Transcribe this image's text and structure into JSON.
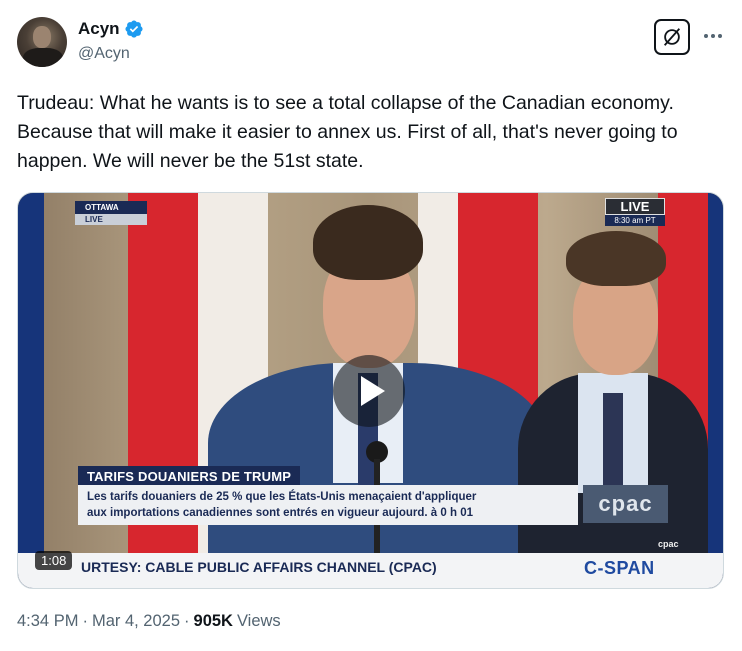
{
  "author": {
    "display_name": "Acyn",
    "handle": "@Acyn",
    "verified": true,
    "verified_color": "#1d9bf0"
  },
  "tweet": {
    "text": "Trudeau: What he wants is to see a total collapse of the Canadian economy. Because that will make it easier to annex us. First of all, that's never going to happen. We will never be the 51st state."
  },
  "video": {
    "duration": "1:08",
    "overlay": {
      "location_label": "OTTAWA",
      "location_sub": "LIVE",
      "live_label": "LIVE",
      "live_time": "8:30 am PT",
      "chyron_title": "TARIFS DOUANIERS DE TRUMP",
      "chyron_line1": "Les tarifs douaniers de 25 % que les États-Unis menaçaient d'appliquer",
      "chyron_line2": "aux importations canadiennes sont entrés en vigueur aujourd. à 0 h 01",
      "cpac_logo": "cpac",
      "cpac_small": "cpac",
      "courtesy": "URTESY: CABLE PUBLIC AFFAIRS CHANNEL (CPAC)",
      "cspan": "C-SPAN"
    }
  },
  "meta": {
    "time": "4:34 PM",
    "separator": "·",
    "date": "Mar 4, 2025",
    "views_count": "905K",
    "views_label": "Views"
  },
  "icons": {
    "grok": "grok-icon",
    "more": "more-icon",
    "play": "play-icon",
    "verified": "verified-badge-icon"
  }
}
